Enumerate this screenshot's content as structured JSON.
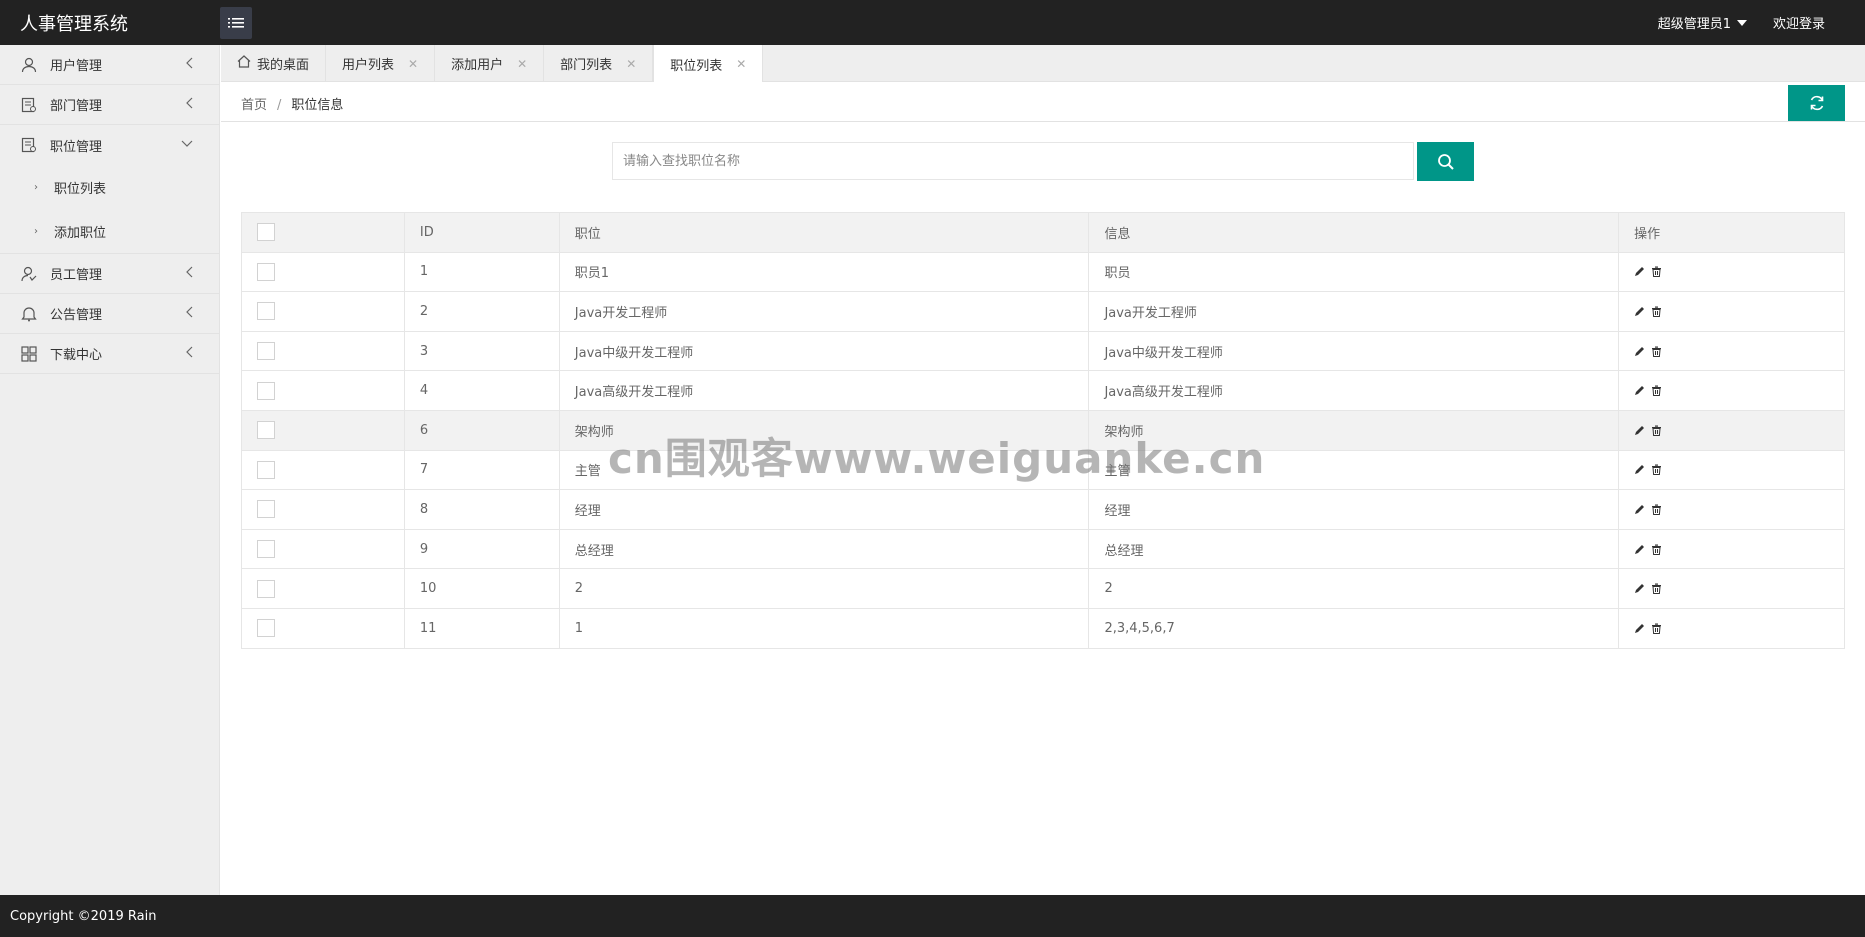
{
  "header": {
    "logo": "人事管理系统",
    "user_name": "超级管理员1",
    "welcome": "欢迎登录"
  },
  "sidebar": {
    "items": [
      {
        "label": "用户管理",
        "icon": "user-icon",
        "expanded": false
      },
      {
        "label": "部门管理",
        "icon": "department-icon",
        "expanded": false
      },
      {
        "label": "职位管理",
        "icon": "position-icon",
        "expanded": true,
        "children": [
          {
            "label": "职位列表"
          },
          {
            "label": "添加职位"
          }
        ]
      },
      {
        "label": "员工管理",
        "icon": "employee-icon",
        "expanded": false
      },
      {
        "label": "公告管理",
        "icon": "notice-icon",
        "expanded": false
      },
      {
        "label": "下载中心",
        "icon": "grid-icon",
        "expanded": false
      }
    ]
  },
  "tabs": [
    {
      "label": "我的桌面"
    },
    {
      "label": "用户列表"
    },
    {
      "label": "添加用户"
    },
    {
      "label": "部门列表"
    },
    {
      "label": "职位列表",
      "active": true
    }
  ],
  "breadcrumb": {
    "home": "首页",
    "separator": "/",
    "current": "职位信息"
  },
  "search": {
    "placeholder": "请输入查找职位名称",
    "value": ""
  },
  "table": {
    "columns": [
      "ID",
      "职位",
      "信息",
      "操作"
    ],
    "rows": [
      {
        "id": "1",
        "name": "职员1",
        "info": "职员"
      },
      {
        "id": "2",
        "name": "Java开发工程师",
        "info": "Java开发工程师"
      },
      {
        "id": "3",
        "name": "Java中级开发工程师",
        "info": "Java中级开发工程师"
      },
      {
        "id": "4",
        "name": "Java高级开发工程师",
        "info": "Java高级开发工程师"
      },
      {
        "id": "6",
        "name": "架构师",
        "info": "架构师"
      },
      {
        "id": "7",
        "name": "主管",
        "info": "主管"
      },
      {
        "id": "8",
        "name": "经理",
        "info": "经理"
      },
      {
        "id": "9",
        "name": "总经理",
        "info": "总经理"
      },
      {
        "id": "10",
        "name": "2",
        "info": "2"
      },
      {
        "id": "11",
        "name": "1",
        "info": "2,3,4,5,6,7"
      }
    ]
  },
  "watermark": "cn围观客www.weiguanke.cn",
  "footer": {
    "copyright": "Copyright ©2019 Rain"
  },
  "colors": {
    "accent": "#009688",
    "header_bg": "#222222",
    "sidebar_bg": "#eeeeee"
  }
}
